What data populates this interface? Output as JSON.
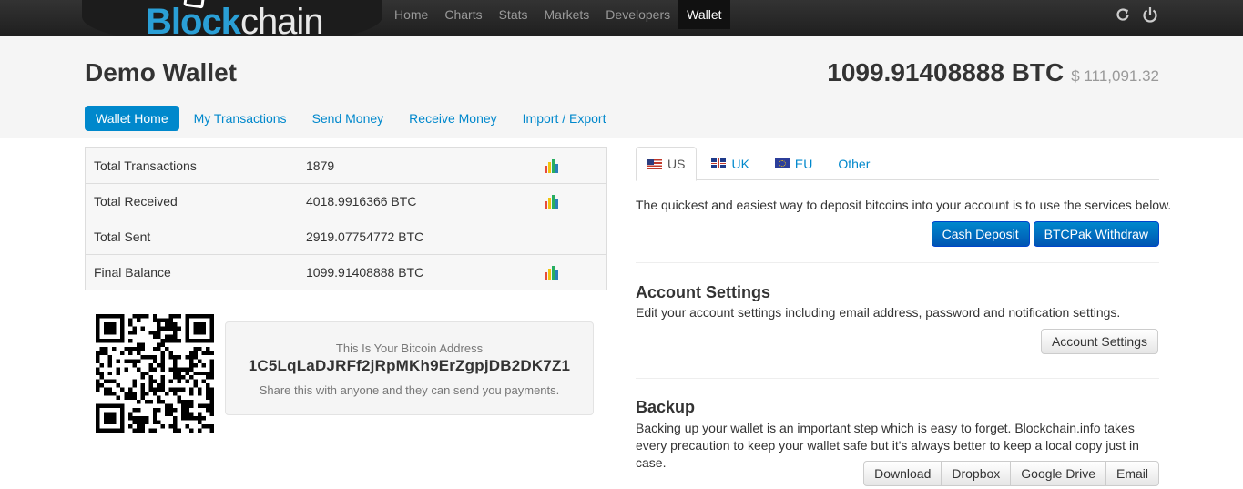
{
  "nav": {
    "logo_prefix": "Blockchain",
    "links": [
      "Home",
      "Charts",
      "Stats",
      "Markets",
      "Developers",
      "Wallet"
    ],
    "active": "Wallet",
    "icons": [
      "refresh-icon",
      "power-icon"
    ]
  },
  "header": {
    "title": "Demo Wallet",
    "balance_btc": "1099.91408888 BTC",
    "balance_usd": "$ 111,091.32",
    "tabs": [
      "Wallet Home",
      "My Transactions",
      "Send Money",
      "Receive Money",
      "Import / Export"
    ]
  },
  "stats": {
    "rows": [
      {
        "label": "Total Transactions",
        "value": "1879",
        "chart": true
      },
      {
        "label": "Total Received",
        "value": "4018.9916366 BTC",
        "chart": true
      },
      {
        "label": "Total Sent",
        "value": "2919.07754772 BTC",
        "chart": false
      },
      {
        "label": "Final Balance",
        "value": "1099.91408888 BTC",
        "chart": true
      }
    ]
  },
  "address": {
    "label": "This Is Your Bitcoin Address",
    "value": "1C5LqLaDJRFf2jRpMKh9ErZgpjDB2DK7Z1",
    "hint": "Share this with anyone and they can send you payments."
  },
  "deposit": {
    "tabs": [
      "US",
      "UK",
      "EU",
      "Other"
    ],
    "text": "The quickest and easiest way to deposit bitcoins into your account is to use the services below.",
    "buttons": [
      "Cash Deposit",
      "BTCPak Withdraw"
    ]
  },
  "account_settings": {
    "title": "Account Settings",
    "text": "Edit your account settings including email address, password and notification settings.",
    "button": "Account Settings"
  },
  "backup": {
    "title": "Backup",
    "text": "Backing up your wallet is an important step which is easy to forget. Blockchain.info takes every precaution to keep your wallet safe but it's always better to keep a local copy just in case.",
    "buttons": [
      "Download",
      "Dropbox",
      "Google Drive",
      "Email"
    ]
  },
  "colors": {
    "brand_blue": "#2a9fd6",
    "link": "#0088cc",
    "navbar": "#222222"
  }
}
